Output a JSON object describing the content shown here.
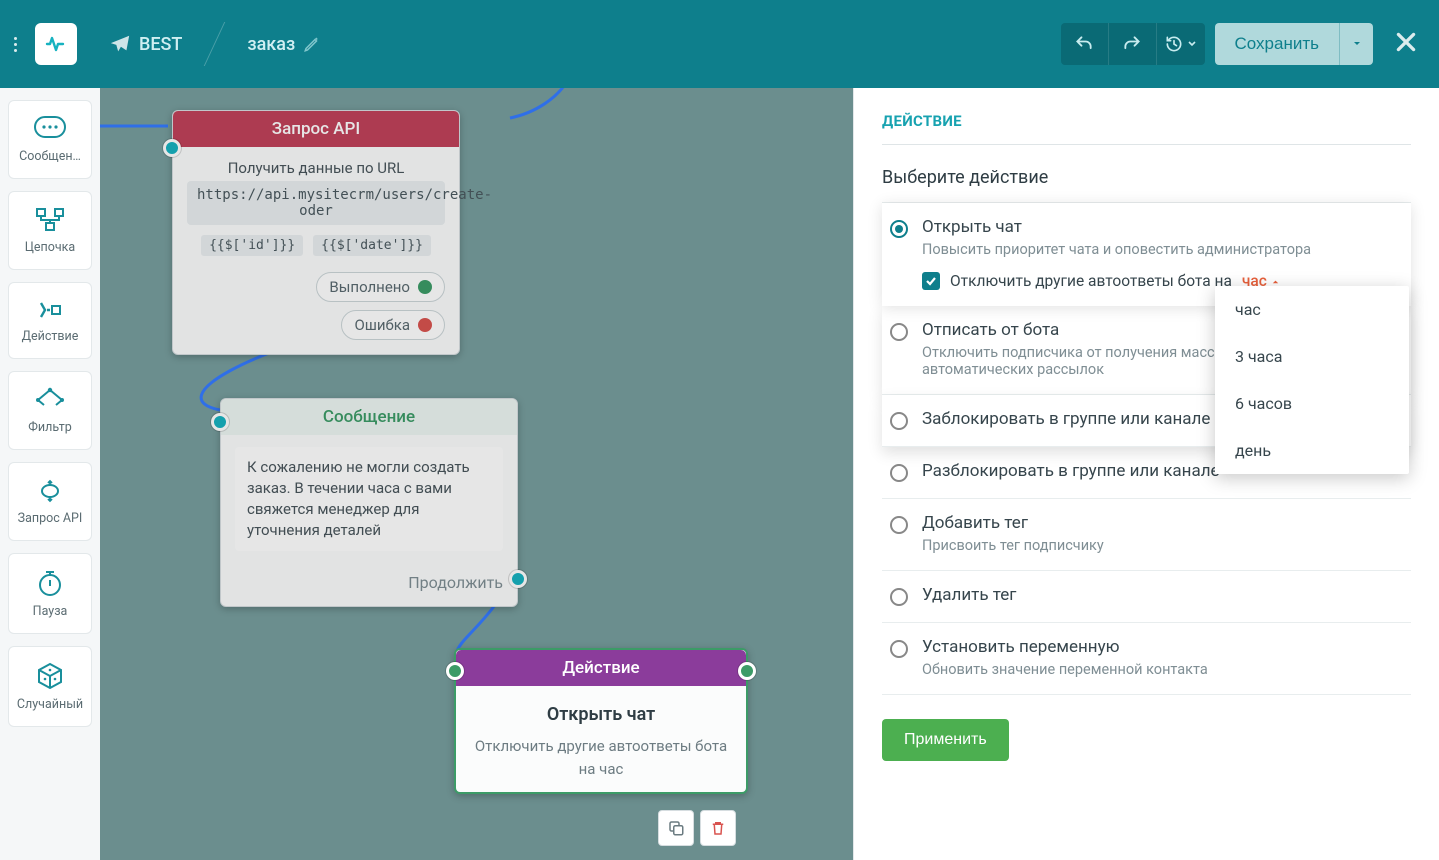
{
  "header": {
    "bot_name": "BEST",
    "flow_name": "заказ",
    "save_label": "Сохранить"
  },
  "sidebar": {
    "items": [
      {
        "label": "Сообщен…"
      },
      {
        "label": "Цепочка"
      },
      {
        "label": "Действие"
      },
      {
        "label": "Фильтр"
      },
      {
        "label": "Запрос API"
      },
      {
        "label": "Пауза"
      },
      {
        "label": "Случайный"
      }
    ]
  },
  "canvas": {
    "nodes": {
      "api": {
        "title": "Запрос API",
        "subtitle": "Получить данные по URL",
        "url": "https://api.mysitecrm/users/create-oder",
        "tags": [
          "{{$['id']}}",
          "{{$['date']}}"
        ],
        "success_label": "Выполнено",
        "error_label": "Ошибка"
      },
      "message": {
        "title": "Сообщение",
        "text": "К сожалению не могли создать заказ. В течении часа с вами свяжется менеджер для уточнения деталей",
        "continue_label": "Продолжить"
      },
      "action": {
        "title": "Действие",
        "subtitle": "Открыть чат",
        "text": "Отключить другие автоответы бота на  час"
      }
    }
  },
  "panel": {
    "title": "ДЕЙСТВИЕ",
    "select_label": "Выберите действие",
    "options": [
      {
        "title": "Открыть чат",
        "desc": "Повысить приоритет чата и оповестить администратора",
        "selected": true,
        "disable_label": "Отключить другие автоответы бота на",
        "hour_label": "час"
      },
      {
        "title": "Отписать от бота",
        "desc": "Отключить подписчика от получения массовых и автоматических рассылок"
      },
      {
        "title": "Заблокировать в группе или канале"
      },
      {
        "title": "Разблокировать в группе или канале"
      },
      {
        "title": "Добавить тег",
        "desc": "Присвоить тег подписчику"
      },
      {
        "title": "Удалить тег"
      },
      {
        "title": "Установить переменную",
        "desc": "Обновить значение переменной контакта"
      }
    ],
    "dropdown": [
      "час",
      "3 часа",
      "6 часов",
      "день"
    ],
    "apply_label": "Применить"
  }
}
